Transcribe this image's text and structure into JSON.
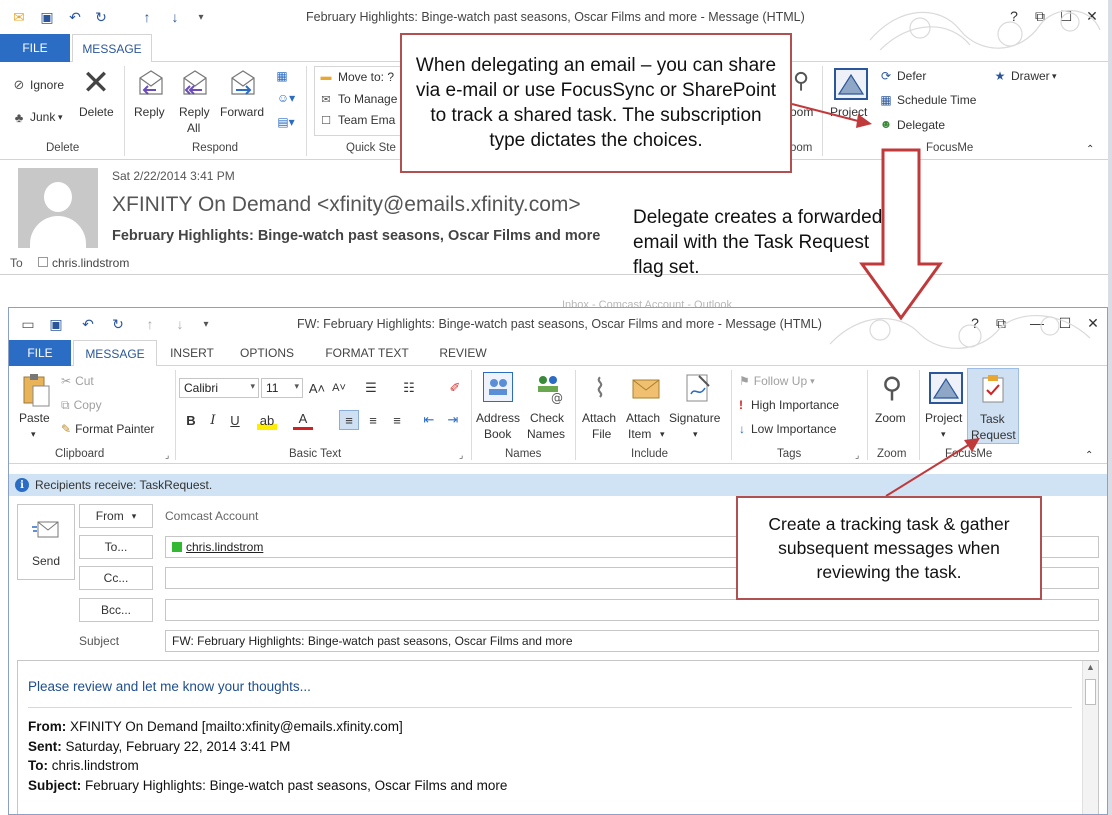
{
  "top": {
    "title": "February Highlights: Binge-watch past seasons, Oscar Films and more - Message (HTML)",
    "tabs": {
      "file": "FILE",
      "message": "MESSAGE"
    },
    "ribbon": {
      "ignore": "Ignore",
      "junk": "Junk",
      "delete": "Delete",
      "reply": "Reply",
      "reply_all_1": "Reply",
      "reply_all_2": "All",
      "forward": "Forward",
      "move_to": "Move to: ?",
      "to_manager": "To Manage",
      "team_email": "Team Ema",
      "zoom_partial": "oom",
      "project": "Project",
      "defer": "Defer",
      "schedule_time": "Schedule Time",
      "delegate": "Delegate",
      "drawer": "Drawer",
      "groups": {
        "delete": "Delete",
        "respond": "Respond",
        "quick_steps": "Quick Ste",
        "zoom": "oom",
        "focusme": "FocusMe"
      }
    },
    "header": {
      "date": "Sat 2/22/2014 3:41 PM",
      "sender": "XFINITY On Demand <xfinity@emails.xfinity.com>",
      "subject": "February Highlights: Binge-watch past seasons, Oscar Films and more",
      "to_label": "To",
      "to_value": "chris.lindstrom"
    }
  },
  "bottom": {
    "title": "FW: February Highlights: Binge-watch past seasons, Oscar Films and more - Message (HTML)",
    "tabs": [
      "FILE",
      "MESSAGE",
      "INSERT",
      "OPTIONS",
      "FORMAT TEXT",
      "REVIEW"
    ],
    "ribbon": {
      "paste": "Paste",
      "cut": "Cut",
      "copy": "Copy",
      "format_painter": "Format Painter",
      "font": "Calibri",
      "font_size": "11",
      "address_1": "Address",
      "address_2": "Book",
      "check_1": "Check",
      "check_2": "Names",
      "attach_file_1": "Attach",
      "attach_file_2": "File",
      "attach_item_1": "Attach",
      "attach_item_2": "Item",
      "signature": "Signature",
      "follow_up": "Follow Up",
      "high_importance": "High Importance",
      "low_importance": "Low Importance",
      "zoom": "Zoom",
      "project": "Project",
      "task_1": "Task",
      "task_2": "Request",
      "groups": {
        "clipboard": "Clipboard",
        "basic_text": "Basic Text",
        "names": "Names",
        "include": "Include",
        "tags": "Tags",
        "zoom": "Zoom",
        "focusme": "FocusMe"
      }
    },
    "infobar": "Recipients receive: TaskRequest.",
    "compose": {
      "send": "Send",
      "from_btn": "From",
      "from_value": "Comcast Account",
      "to_btn": "To...",
      "to_value": "chris.lindstrom",
      "cc_btn": "Cc...",
      "bcc_btn": "Bcc...",
      "subject_label": "Subject",
      "subject_value": "FW: February Highlights: Binge-watch past seasons, Oscar Films and more"
    },
    "body": {
      "intro": "Please review and let me know your thoughts...",
      "from_label": "From:",
      "from_value": " XFINITY On Demand [mailto:xfinity@emails.xfinity.com]",
      "sent_label": "Sent:",
      "sent_value": " Saturday, February 22, 2014 3:41 PM",
      "to_label": "To:",
      "to_value": " chris.lindstrom",
      "subject_label": "Subject:",
      "subject_value": " February Highlights: Binge-watch past seasons, Oscar Films and more"
    },
    "bg_text": "Inbox - Comcast Account - Outlook"
  },
  "callouts": {
    "delegating": "When delegating an email – you can share via e-mail or use FocusSync or SharePoint to track a shared task.  The subscription type dictates the choices.",
    "delegate_creates": "Delegate creates a forwarded email with the Task Request flag set.",
    "tracking": "Create a tracking task & gather subsequent messages when reviewing the task."
  },
  "colors": {
    "file_tab": "#2b6cc4",
    "callout_border": "#b05050",
    "arrow": "#c0393b",
    "infobar": "#cfe3f4",
    "accent": "#2b579a"
  }
}
